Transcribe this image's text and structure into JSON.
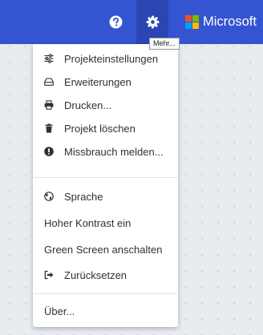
{
  "header": {
    "help_icon": "question-circle-icon",
    "settings_icon": "gear-icon",
    "tooltip": "Mehr...",
    "brand": {
      "name": "Microsoft",
      "colors": [
        "#f25022",
        "#7fba00",
        "#00a4ef",
        "#ffb900"
      ]
    },
    "color": "#3454d1"
  },
  "menu": {
    "group1": [
      {
        "label": "Projekteinstellungen",
        "icon": "sliders-icon"
      },
      {
        "label": "Erweiterungen",
        "icon": "drive-icon"
      },
      {
        "label": "Drucken...",
        "icon": "printer-icon"
      },
      {
        "label": "Projekt löschen",
        "icon": "trash-icon"
      },
      {
        "label": "Missbrauch melden...",
        "icon": "exclamation-circle-icon"
      }
    ],
    "group2": [
      {
        "label": "Sprache",
        "icon": "globe-icon"
      },
      {
        "label": "Hoher Kontrast ein",
        "icon": ""
      },
      {
        "label": "Green Screen anschalten",
        "icon": ""
      },
      {
        "label": "Zurücksetzen",
        "icon": "sign-out-icon"
      }
    ],
    "group3": [
      {
        "label": "Über...",
        "icon": ""
      }
    ]
  }
}
